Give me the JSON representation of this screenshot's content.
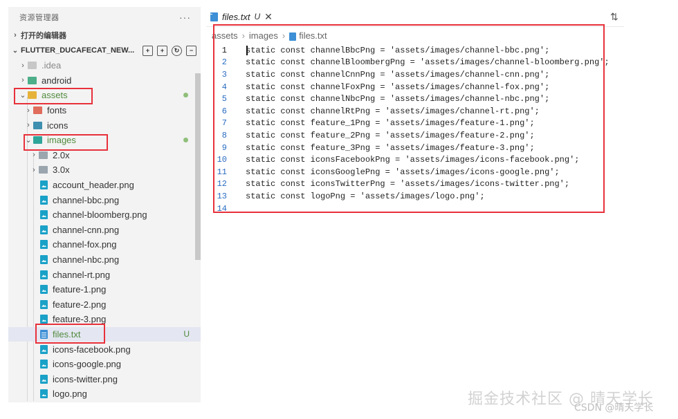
{
  "sidebar": {
    "header_title": "资源管理器",
    "more": "···",
    "open_editors": "打开的编辑器",
    "project": "FLUTTER_DUCAFECAT_NEW...",
    "tree": [
      {
        "label": ".idea"
      },
      {
        "label": "android"
      },
      {
        "label": "assets"
      },
      {
        "label": "fonts"
      },
      {
        "label": "icons"
      },
      {
        "label": "images"
      },
      {
        "label": "2.0x"
      },
      {
        "label": "3.0x"
      },
      {
        "label": "account_header.png"
      },
      {
        "label": "channel-bbc.png"
      },
      {
        "label": "channel-bloomberg.png"
      },
      {
        "label": "channel-cnn.png"
      },
      {
        "label": "channel-fox.png"
      },
      {
        "label": "channel-nbc.png"
      },
      {
        "label": "channel-rt.png"
      },
      {
        "label": "feature-1.png"
      },
      {
        "label": "feature-2.png"
      },
      {
        "label": "feature-3.png"
      },
      {
        "label": "files.txt",
        "badge": "U"
      },
      {
        "label": "icons-facebook.png"
      },
      {
        "label": "icons-google.png"
      },
      {
        "label": "icons-twitter.png"
      },
      {
        "label": "logo.png"
      }
    ]
  },
  "editor": {
    "tab_name": "files.txt",
    "tab_status": "U",
    "close_glyph": "✕",
    "breadcrumb": [
      "assets",
      "images",
      "files.txt"
    ],
    "lines": [
      {
        "n": "1",
        "code": "static const channelBbcPng = 'assets/images/channel-bbc.png';"
      },
      {
        "n": "2",
        "code": "static const channelBloombergPng = 'assets/images/channel-bloomberg.png';"
      },
      {
        "n": "3",
        "code": "static const channelCnnPng = 'assets/images/channel-cnn.png';"
      },
      {
        "n": "4",
        "code": "static const channelFoxPng = 'assets/images/channel-fox.png';"
      },
      {
        "n": "5",
        "code": "static const channelNbcPng = 'assets/images/channel-nbc.png';"
      },
      {
        "n": "6",
        "code": "static const channelRtPng = 'assets/images/channel-rt.png';"
      },
      {
        "n": "7",
        "code": "static const feature_1Png = 'assets/images/feature-1.png';"
      },
      {
        "n": "8",
        "code": "static const feature_2Png = 'assets/images/feature-2.png';"
      },
      {
        "n": "9",
        "code": "static const feature_3Png = 'assets/images/feature-3.png';"
      },
      {
        "n": "10",
        "code": "static const iconsFacebookPng = 'assets/images/icons-facebook.png';"
      },
      {
        "n": "11",
        "code": "static const iconsGooglePng = 'assets/images/icons-google.png';"
      },
      {
        "n": "12",
        "code": "static const iconsTwitterPng = 'assets/images/icons-twitter.png';"
      },
      {
        "n": "13",
        "code": "static const logoPng = 'assets/images/logo.png';"
      },
      {
        "n": "14",
        "code": ""
      }
    ]
  },
  "watermark": {
    "main": "掘金技术社区 @ 晴天学长",
    "sub": "CSDN @晴天学长"
  }
}
